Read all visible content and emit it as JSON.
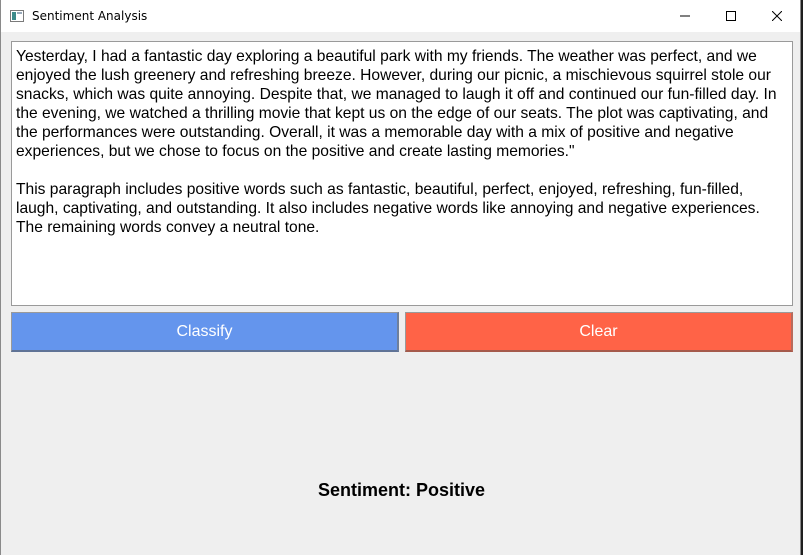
{
  "window": {
    "title": "Sentiment Analysis"
  },
  "input": {
    "text": "Yesterday, I had a fantastic day exploring a beautiful park with my friends. The weather was perfect, and we enjoyed the lush greenery and refreshing breeze. However, during our picnic, a mischievous squirrel stole our snacks, which was quite annoying. Despite that, we managed to laugh it off and continued our fun-filled day. In the evening, we watched a thrilling movie that kept us on the edge of our seats. The plot was captivating, and the performances were outstanding. Overall, it was a memorable day with a mix of positive and negative experiences, but we chose to focus on the positive and create lasting memories.\"\n\nThis paragraph includes positive words such as fantastic, beautiful, perfect, enjoyed, refreshing, fun-filled, laugh, captivating, and outstanding. It also includes negative words like annoying and negative experiences. The remaining words convey a neutral tone."
  },
  "buttons": {
    "classify_label": "Classify",
    "clear_label": "Clear"
  },
  "result": {
    "label": "Sentiment: Positive"
  },
  "colors": {
    "classify": "#6495ed",
    "clear": "#ff6347",
    "background": "#efefef"
  },
  "icons": {
    "app": "app-icon",
    "minimize": "minimize-icon",
    "maximize": "maximize-icon",
    "close": "close-icon"
  }
}
